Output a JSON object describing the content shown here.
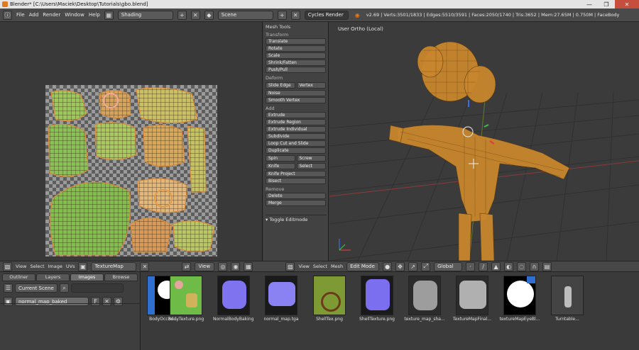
{
  "window": {
    "title": "Blender* [C:\\Users\\Maciek\\Desktop\\Tutorials\\gbo.blend]",
    "controls": [
      "—",
      "❐",
      "✕"
    ]
  },
  "infobar": {
    "menus": [
      "File",
      "Add",
      "Render",
      "Window",
      "Help"
    ],
    "layout": "Shading",
    "scene": "Scene",
    "engine": "Cycles Render",
    "stats": "v2.69 | Verts:3501/1833 | Edges:5510/3591 | Faces:2050/1740 | Tris:3652 | Mem:27.65M | 0.750M | FaceBody"
  },
  "toolshelf": {
    "title": "Mesh Tools",
    "sections": [
      {
        "name": "Transform",
        "buttons": [
          [
            "Translate"
          ],
          [
            "Rotate"
          ],
          [
            "Scale"
          ],
          [
            "Shrink/Fatten"
          ],
          [
            "Push/Pull"
          ]
        ]
      },
      {
        "name": "Deform",
        "buttons": [
          [
            "Slide Edge",
            "Vertex"
          ],
          [
            "Noise"
          ],
          [
            "Smooth Vertex"
          ]
        ]
      },
      {
        "name": "Add",
        "buttons": [
          [
            "Extrude"
          ],
          [
            "Extrude Region"
          ],
          [
            "Extrude Individual"
          ],
          [
            "Subdivide"
          ],
          [
            "Loop Cut and Slide"
          ],
          [
            "Duplicate"
          ],
          [
            "Spin",
            "Screw"
          ],
          [
            "Knife",
            "Select"
          ],
          [
            "Knife Project"
          ],
          [
            "Bisect"
          ]
        ]
      },
      {
        "name": "Remove",
        "buttons": [
          [
            "Delete"
          ],
          [
            "Merge"
          ]
        ]
      }
    ],
    "toggle": "Toggle Editmode"
  },
  "viewport": {
    "label": "User Ortho (Local)"
  },
  "toolbars": {
    "uv_menus": [
      "View",
      "Select",
      "Image",
      "UVs"
    ],
    "uv_image": "TextureMap",
    "uv_view": "View",
    "view3d_menus": [
      "View",
      "Select",
      "Mesh"
    ],
    "mode": "Edit Mode",
    "orientation": "Global"
  },
  "outliner": {
    "tabs": [
      "Outliner",
      "Layers",
      "Images",
      "Browse"
    ],
    "active_tab": "Images",
    "filter": "Current Scene",
    "search_placeholder": "",
    "item": "normal_map_baked"
  },
  "browser": {
    "items": [
      {
        "caption": "BodyOcc3d...",
        "kind": "dark-blue"
      },
      {
        "caption": "BodyTexture.png",
        "kind": "green-texture"
      },
      {
        "caption": "NormalBodyBaking...",
        "kind": "normal-purple"
      },
      {
        "caption": "normal_map.tga",
        "kind": "normal-purple-2"
      },
      {
        "caption": "ShellTex.png",
        "kind": "green-shell"
      },
      {
        "caption": "ShellTexture.png",
        "kind": "normal-purple-3"
      },
      {
        "caption": "texture_map_sha...",
        "kind": "grey-1"
      },
      {
        "caption": "TextureMapFinal...",
        "kind": "grey-2"
      },
      {
        "caption": "textureMapEyeBl...",
        "kind": "eye-black"
      },
      {
        "caption": "Turntable...",
        "kind": "render"
      }
    ]
  },
  "colors": {
    "accent": "#e07a1c",
    "uv_green": "#7fbf4b",
    "uv_orange": "#d98a3a",
    "normal_purple": "#7f73f0",
    "mesh_orange": "#c8862d"
  }
}
